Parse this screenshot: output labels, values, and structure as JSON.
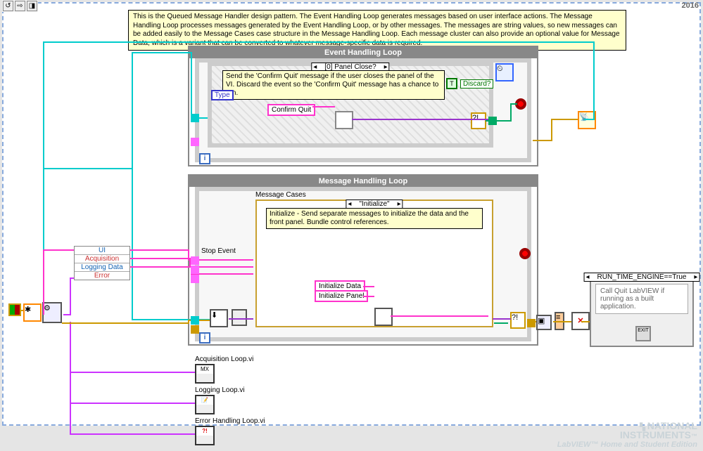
{
  "meta": {
    "year": "2016"
  },
  "toolbar": {
    "btn1": "↺",
    "btn2": "⇨",
    "btn3": "◨"
  },
  "description": "This is the Queued Message Handler design pattern. The Event Handling Loop generates messages based on user interface actions. The Message Handling Loop processes messages generated by the Event Handling Loop, or by other messages.  The messages are string values, so new messages can be added easily to the Message Cases case structure in the Message Handling Loop.  Each message cluster can also provide an optional value for Message Data, which is a variant that can be converted to whatever message-specific data is required.",
  "event_loop": {
    "title": "Event Handling Loop",
    "case_label": "[0] Panel Close?",
    "note": "Send the 'Confirm Quit' message if the user closes the panel of the VI. Discard the event so the 'Confirm Quit' message has a chance to run.",
    "const": "Confirm Quit",
    "discard": "Discard?",
    "type": "Type",
    "iter": "i"
  },
  "msg_loop": {
    "title": "Message Handling Loop",
    "cases_heading": "Message Cases",
    "case_label": "\"Initialize\"",
    "note": "Initialize - Send separate messages to initialize the data and the front panel.  Bundle control references.",
    "stop_label": "Stop Event",
    "const1": "Initialize Data",
    "const2": "Initialize Panel",
    "iter": "i"
  },
  "bundle_items": [
    "UI",
    "Acquisition",
    "Logging Data",
    "Error"
  ],
  "subvis": {
    "acq": "Acquisition Loop.vi",
    "log": "Logging Loop.vi",
    "err": "Error Handling Loop.vi"
  },
  "right_case": {
    "label": "RUN_TIME_ENGINE==True",
    "note": "Call Quit LabVIEW if running as a built application.",
    "exit_glyph": "✕",
    "exit_icon": "EXIT"
  },
  "watermark": {
    "line1": "NATIONAL",
    "line2": "INSTRUMENTS",
    "line3": "LabVIEW™ Home and Student Edition"
  },
  "colors": {
    "wire_pink": "#ff33cc",
    "wire_cyan": "#00cccc",
    "wire_yellow": "#cc9900",
    "wire_green": "#0a6"
  }
}
